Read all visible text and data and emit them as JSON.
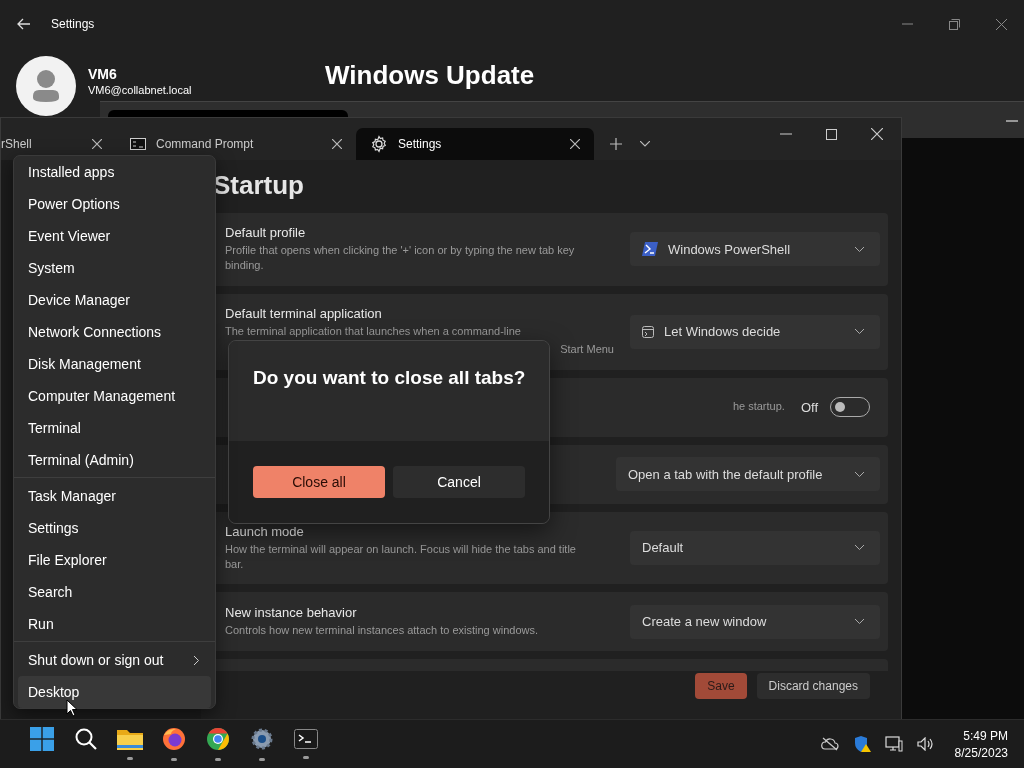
{
  "settings_window": {
    "title": "Settings",
    "user": {
      "name": "VM6",
      "email": "VM6@collabnet.local"
    },
    "page_title": "Windows Update"
  },
  "terminal": {
    "tabs": [
      {
        "label": "rShell",
        "selected": false
      },
      {
        "label": "Command Prompt",
        "kind": "cmd",
        "selected": false
      },
      {
        "label": "Settings",
        "kind": "settings",
        "selected": true
      }
    ],
    "page_title": "Startup",
    "rows": [
      {
        "kind": "dropdown",
        "title": "Default profile",
        "description": "Profile that opens when clicking the '+' icon or by typing the new tab key binding.",
        "value": "Windows PowerShell"
      },
      {
        "kind": "dropdown",
        "title": "Default terminal application",
        "description": "The terminal application that launches when a command-line",
        "description_tail": "Start Menu",
        "value": "Let Windows decide"
      },
      {
        "kind": "toggle",
        "description_tail": "he startup.",
        "state_label": "Off",
        "on": false
      },
      {
        "kind": "dropdown",
        "value": "Open a tab with the default profile"
      },
      {
        "kind": "dropdown",
        "title": "Launch mode",
        "description": "How the terminal will appear on launch. Focus will hide the tabs and title bar.",
        "value": "Default"
      },
      {
        "kind": "dropdown",
        "title": "New instance behavior",
        "description": "Controls how new terminal instances attach to existing windows.",
        "value": "Create a new window"
      }
    ],
    "footer": {
      "save": "Save",
      "discard": "Discard changes"
    }
  },
  "dialog": {
    "title": "Do you want to close all tabs?",
    "buttons": [
      {
        "label": "Close all",
        "kind": "primary"
      },
      {
        "label": "Cancel",
        "kind": "secondary"
      }
    ]
  },
  "menu": {
    "groups": [
      {
        "items": [
          {
            "label": "Installed apps",
            "selected": false
          },
          {
            "label": "Power Options",
            "selected": false
          },
          {
            "label": "Event Viewer",
            "selected": false
          },
          {
            "label": "System",
            "selected": false
          },
          {
            "label": "Device Manager",
            "selected": false
          },
          {
            "label": "Network Connections",
            "selected": false
          },
          {
            "label": "Disk Management",
            "selected": false
          },
          {
            "label": "Computer Management",
            "selected": false
          },
          {
            "label": "Terminal",
            "selected": false
          },
          {
            "label": "Terminal (Admin)",
            "selected": false
          }
        ]
      },
      {
        "items": [
          {
            "label": "Task Manager",
            "selected": false
          },
          {
            "label": "Settings",
            "selected": false
          },
          {
            "label": "File Explorer",
            "selected": false
          },
          {
            "label": "Search",
            "selected": false
          },
          {
            "label": "Run",
            "selected": false
          }
        ]
      },
      {
        "items": [
          {
            "label": "Shut down or sign out",
            "kind": "submenu",
            "selected": false
          },
          {
            "label": "Desktop",
            "selected": true
          }
        ]
      }
    ]
  },
  "taskbar": {
    "apps": [
      {
        "kind": "start",
        "running": false
      },
      {
        "kind": "search",
        "running": false
      },
      {
        "kind": "explorer",
        "running": true
      },
      {
        "kind": "firefox",
        "running": true
      },
      {
        "kind": "chrome",
        "running": true
      },
      {
        "kind": "settings",
        "running": true
      },
      {
        "kind": "terminal",
        "running": true
      }
    ],
    "time": "5:49 PM",
    "date": "8/25/2023"
  }
}
